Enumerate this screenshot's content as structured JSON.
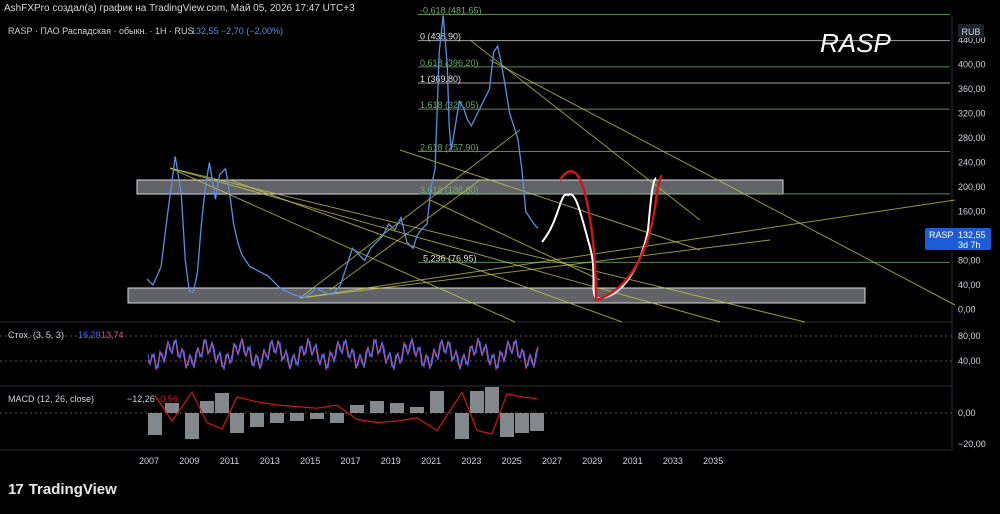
{
  "header": {
    "attribution": "AshFXPro создал(а) график на TradingView.com, Май 05, 2026 17:47 UTC+3"
  },
  "legend": {
    "symbol": "RASP · ПАО Распадская · обыкн. · 1H · RUS",
    "price": "132,55",
    "change": "−2,70 (−2,00%)"
  },
  "watermark": "RASP",
  "currency": "RUB",
  "price_tag": {
    "symbol": "RASP",
    "price": "132,55",
    "countdown": "3d 7h"
  },
  "fib_labels": [
    {
      "text": "-0,618 (481,65)",
      "price": 481.65
    },
    {
      "text": "0 (438,90)",
      "price": 438.9
    },
    {
      "text": "0,618 (396,20)",
      "price": 396.2
    },
    {
      "text": "1 (369,80)",
      "price": 369.8
    },
    {
      "text": "1,618 (327,05)",
      "price": 327.05
    },
    {
      "text": "2,618 (257,90)",
      "price": 257.9
    },
    {
      "text": "3,618 (188,80)",
      "price": 188.8
    },
    {
      "text": "5,236 (76,95)",
      "price": 76.95
    }
  ],
  "indicators": {
    "stoch": {
      "label": "Стох. (3, 5, 3)",
      "k": "16,29",
      "d": "13,74",
      "ticks": [
        "80,00",
        "40,00"
      ]
    },
    "macd": {
      "label": "MACD (12, 26, close)",
      "hist": "−12,26",
      "signal": "−0,56",
      "ticks": [
        "0,00",
        "−20,00"
      ]
    }
  },
  "footer": {
    "brand": "TradingView",
    "logo_mark": "17"
  },
  "colors": {
    "price": "#5b8fe0",
    "fib": "#6aaa6a",
    "trend": "#c8c84a",
    "zone": "#b2b5be",
    "projection_red": "#d01616",
    "projection_white": "#ffffff",
    "stoch_k": "#4a6cf7",
    "stoch_d": "#e05090"
  },
  "chart_data": {
    "type": "line",
    "title": "RASP · ПАО Распадская · обыкн. · 1H · RUS",
    "xlabel": "",
    "ylabel": "",
    "x_ticks": [
      "2007",
      "2009",
      "2011",
      "2013",
      "2015",
      "2017",
      "2019",
      "2021",
      "2023",
      "2025",
      "2027",
      "2029",
      "2031",
      "2033",
      "2035"
    ],
    "y_ticks": [
      "440,00",
      "400,00",
      "360,00",
      "320,00",
      "280,00",
      "240,00",
      "200,00",
      "160,00",
      "120,00",
      "80,00",
      "40,00",
      "0,00"
    ],
    "ylim": [
      -10,
      490
    ],
    "xlim": [
      2006.2,
      2036.5
    ],
    "series": [
      {
        "x": [
          2006.9,
          2007.2,
          2007.6,
          2007.9,
          2008.1,
          2008.3,
          2008.6,
          2008.8,
          2009.0,
          2009.2,
          2009.4,
          2009.6,
          2009.8,
          2010.0,
          2010.3,
          2010.5,
          2010.8,
          2011.0,
          2011.2,
          2011.4,
          2011.6,
          2011.8,
          2012.0,
          2012.3,
          2012.6,
          2012.9,
          2013.2,
          2013.5,
          2013.8,
          2014.1,
          2014.4,
          2014.7,
          2015.0,
          2015.3,
          2015.6,
          2015.9,
          2016.2,
          2016.5,
          2016.8,
          2017.1,
          2017.4,
          2017.7,
          2018.0,
          2018.3,
          2018.6,
          2018.9,
          2019.2,
          2019.5,
          2019.8,
          2020.1,
          2020.3,
          2020.5,
          2020.8,
          2021.0,
          2021.2,
          2021.4,
          2021.6,
          2021.8,
          2021.9,
          2022.0,
          2022.2,
          2022.4,
          2022.6,
          2022.8,
          2023.0,
          2023.3,
          2023.6,
          2023.9,
          2024.1,
          2024.3,
          2024.5,
          2024.7,
          2024.9,
          2025.1,
          2025.3,
          2025.5,
          2025.7,
          2025.9,
          2026.1,
          2026.3
        ],
        "y": [
          50,
          40,
          70,
          150,
          200,
          250,
          190,
          80,
          30,
          28,
          60,
          140,
          200,
          240,
          180,
          220,
          230,
          190,
          140,
          110,
          90,
          80,
          70,
          65,
          60,
          55,
          45,
          35,
          30,
          25,
          22,
          20,
          25,
          35,
          30,
          25,
          28,
          40,
          70,
          100,
          90,
          80,
          100,
          110,
          120,
          140,
          130,
          150,
          110,
          100,
          120,
          130,
          140,
          200,
          230,
          420,
          480,
          400,
          300,
          260,
          300,
          340,
          330,
          310,
          300,
          320,
          340,
          360,
          420,
          430,
          400,
          360,
          320,
          300,
          280,
          230,
          160,
          150,
          140,
          132.55
        ]
      }
    ],
    "stoch": {
      "k_last": 16.29,
      "d_last": 13.74,
      "range": [
        0,
        100
      ]
    },
    "macd": {
      "hist_last": -12.26,
      "signal_last": -0.56
    }
  }
}
